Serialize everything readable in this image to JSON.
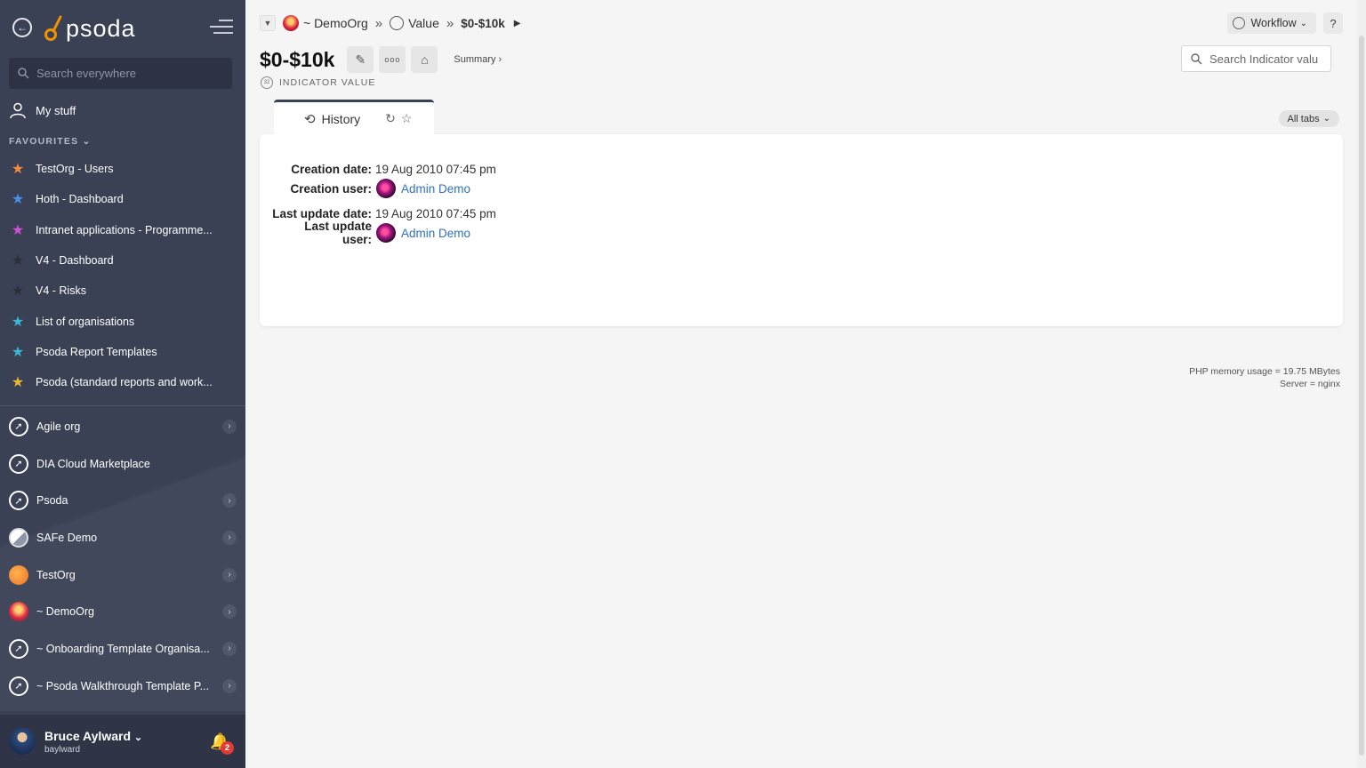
{
  "sidebar": {
    "logo_text": "psoda",
    "search_placeholder": "Search everywhere",
    "my_stuff": "My stuff",
    "favourites_label": "FAVOURITES",
    "favourites": [
      {
        "label": "TestOrg - Users",
        "color": "#f28b3a"
      },
      {
        "label": "Hoth - Dashboard",
        "color": "#4a8fe8"
      },
      {
        "label": "Intranet applications - Programme...",
        "color": "#d04fd6"
      },
      {
        "label": "V4 - Dashboard",
        "color": "#2b2f3b"
      },
      {
        "label": "V4 - Risks",
        "color": "#2b2f3b"
      },
      {
        "label": "List of organisations",
        "color": "#3bb7d6"
      },
      {
        "label": "Psoda Report Templates",
        "color": "#3bb7d6"
      },
      {
        "label": "Psoda (standard reports and work...",
        "color": "#e8b530"
      }
    ],
    "orgs": [
      {
        "label": "Agile org",
        "icon": "rocket",
        "chevron": true
      },
      {
        "label": "DIA Cloud Marketplace",
        "icon": "rocket",
        "chevron": false
      },
      {
        "label": "Psoda",
        "icon": "rocket",
        "chevron": true
      },
      {
        "label": "SAFe Demo",
        "icon": "safe",
        "chevron": true
      },
      {
        "label": "TestOrg",
        "icon": "testorg",
        "chevron": true
      },
      {
        "label": "~ DemoOrg",
        "icon": "demo",
        "chevron": true
      },
      {
        "label": "~ Onboarding Template Organisa...",
        "icon": "rocket",
        "chevron": true
      },
      {
        "label": "~ Psoda Walkthrough Template P...",
        "icon": "rocket",
        "chevron": true
      }
    ],
    "user": {
      "name": "Bruce Aylward",
      "username": "baylward",
      "notifications": "2"
    }
  },
  "breadcrumb": {
    "org": "~ DemoOrg",
    "section": "Value",
    "current": "$0-$10k",
    "sep": "»"
  },
  "toolbar": {
    "workflow": "Workflow",
    "help": "?"
  },
  "page": {
    "title": "$0-$10k",
    "summary": "Summary ›",
    "subtitle": "INDICATOR VALUE",
    "subtitle_icon_text": "32",
    "search_placeholder": "Search Indicator valu"
  },
  "tabs": {
    "history": "History",
    "all_tabs": "All tabs"
  },
  "history": {
    "creation_date_label": "Creation date:",
    "creation_date": "19 Aug 2010 07:45 pm",
    "creation_user_label": "Creation user:",
    "creation_user": "Admin Demo",
    "update_date_label": "Last update date:",
    "update_date": "19 Aug 2010 07:45 pm",
    "update_user_label": "Last update user:",
    "update_user": "Admin Demo"
  },
  "footer": {
    "memory": "PHP memory usage = 19.75 MBytes",
    "server": "Server = nginx"
  }
}
